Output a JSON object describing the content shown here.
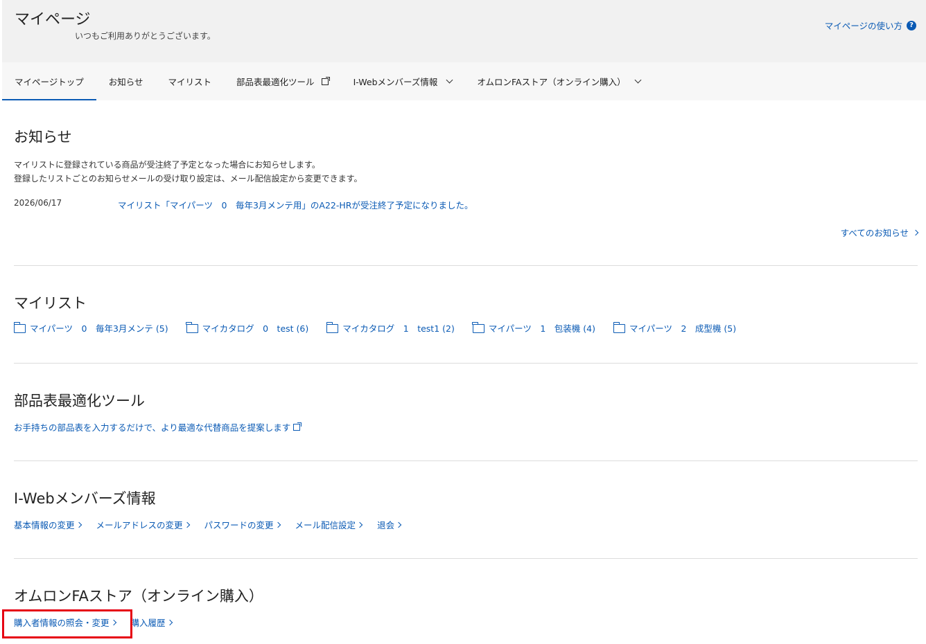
{
  "header": {
    "title": "マイページ",
    "welcome": "いつもご利用ありがとうございます。",
    "help_link": "マイページの使い方",
    "help_icon_glyph": "?"
  },
  "nav": {
    "tabs": [
      {
        "label": "マイページトップ",
        "active": true
      },
      {
        "label": "お知らせ"
      },
      {
        "label": "マイリスト"
      },
      {
        "label": "部品表最適化ツール",
        "icon": "external-link-icon"
      },
      {
        "label": "I-Webメンバーズ情報",
        "icon": "chevron-down-icon"
      },
      {
        "label": "オムロンFAストア（オンライン購入）",
        "icon": "chevron-down-icon"
      }
    ]
  },
  "news": {
    "title": "お知らせ",
    "desc1": "マイリストに登録されている商品が受注終了予定となった場合にお知らせします。",
    "desc2": "登録したリストごとのお知らせメールの受け取り設定は、メール配信設定から変更できます。",
    "items": [
      {
        "date": "2026/06/17",
        "text": "マイリスト「マイパーツ　0　毎年3月メンテ用」のA22-HRが受注終了予定になりました。"
      }
    ],
    "all_link": "すべてのお知らせ"
  },
  "mylist": {
    "title": "マイリスト",
    "folders": [
      {
        "label": "マイパーツ　0　毎年3月メンテ (5)"
      },
      {
        "label": "マイカタログ　0　test (6)"
      },
      {
        "label": "マイカタログ　1　test1 (2)"
      },
      {
        "label": "マイパーツ　1　包装機 (4)"
      },
      {
        "label": "マイパーツ　2　成型機 (5)"
      }
    ]
  },
  "bom": {
    "title": "部品表最適化ツール",
    "link": "お手持ちの部品表を入力するだけで、より最適な代替商品を提案します"
  },
  "members": {
    "title": "I-Webメンバーズ情報",
    "links": [
      "基本情報の変更",
      "メールアドレスの変更",
      "パスワードの変更",
      "メール配信設定",
      "退会"
    ]
  },
  "store": {
    "title": "オムロンFAストア（オンライン購入）",
    "links": [
      "購入者情報の照会・変更",
      "購入履歴"
    ]
  },
  "colors": {
    "link": "#0a5ab4",
    "highlight": "#e60012"
  }
}
